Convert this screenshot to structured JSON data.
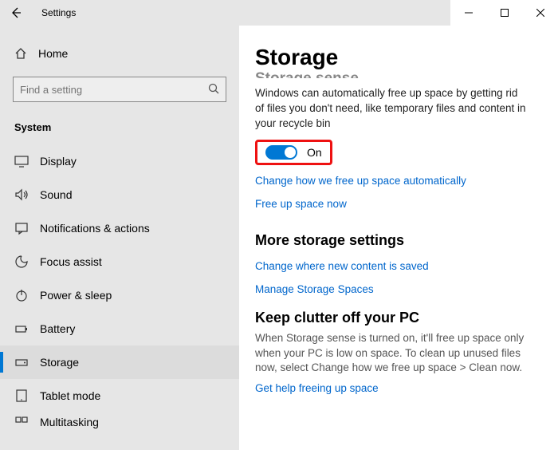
{
  "window": {
    "title": "Settings"
  },
  "sidebar": {
    "home": "Home",
    "search_placeholder": "Find a setting",
    "section": "System",
    "items": [
      {
        "label": "Display"
      },
      {
        "label": "Sound"
      },
      {
        "label": "Notifications & actions"
      },
      {
        "label": "Focus assist"
      },
      {
        "label": "Power & sleep"
      },
      {
        "label": "Battery"
      },
      {
        "label": "Storage"
      },
      {
        "label": "Tablet mode"
      },
      {
        "label": "Multitasking"
      }
    ]
  },
  "content": {
    "page_title": "Storage",
    "cutoff_heading": "Storage sense",
    "storage_sense_desc": "Windows can automatically free up space by getting rid of files you don't need, like temporary files and content in your recycle bin",
    "toggle_state": "On",
    "link_change_auto": "Change how we free up space automatically",
    "link_free_now": "Free up space now",
    "more_heading": "More storage settings",
    "link_change_where": "Change where new content is saved",
    "link_manage_spaces": "Manage Storage Spaces",
    "keep_heading": "Keep clutter off your PC",
    "keep_desc": "When Storage sense is turned on, it'll free up space only when your PC is low on space. To clean up unused files now, select Change how we free up space > Clean now.",
    "link_help": "Get help freeing up space"
  }
}
